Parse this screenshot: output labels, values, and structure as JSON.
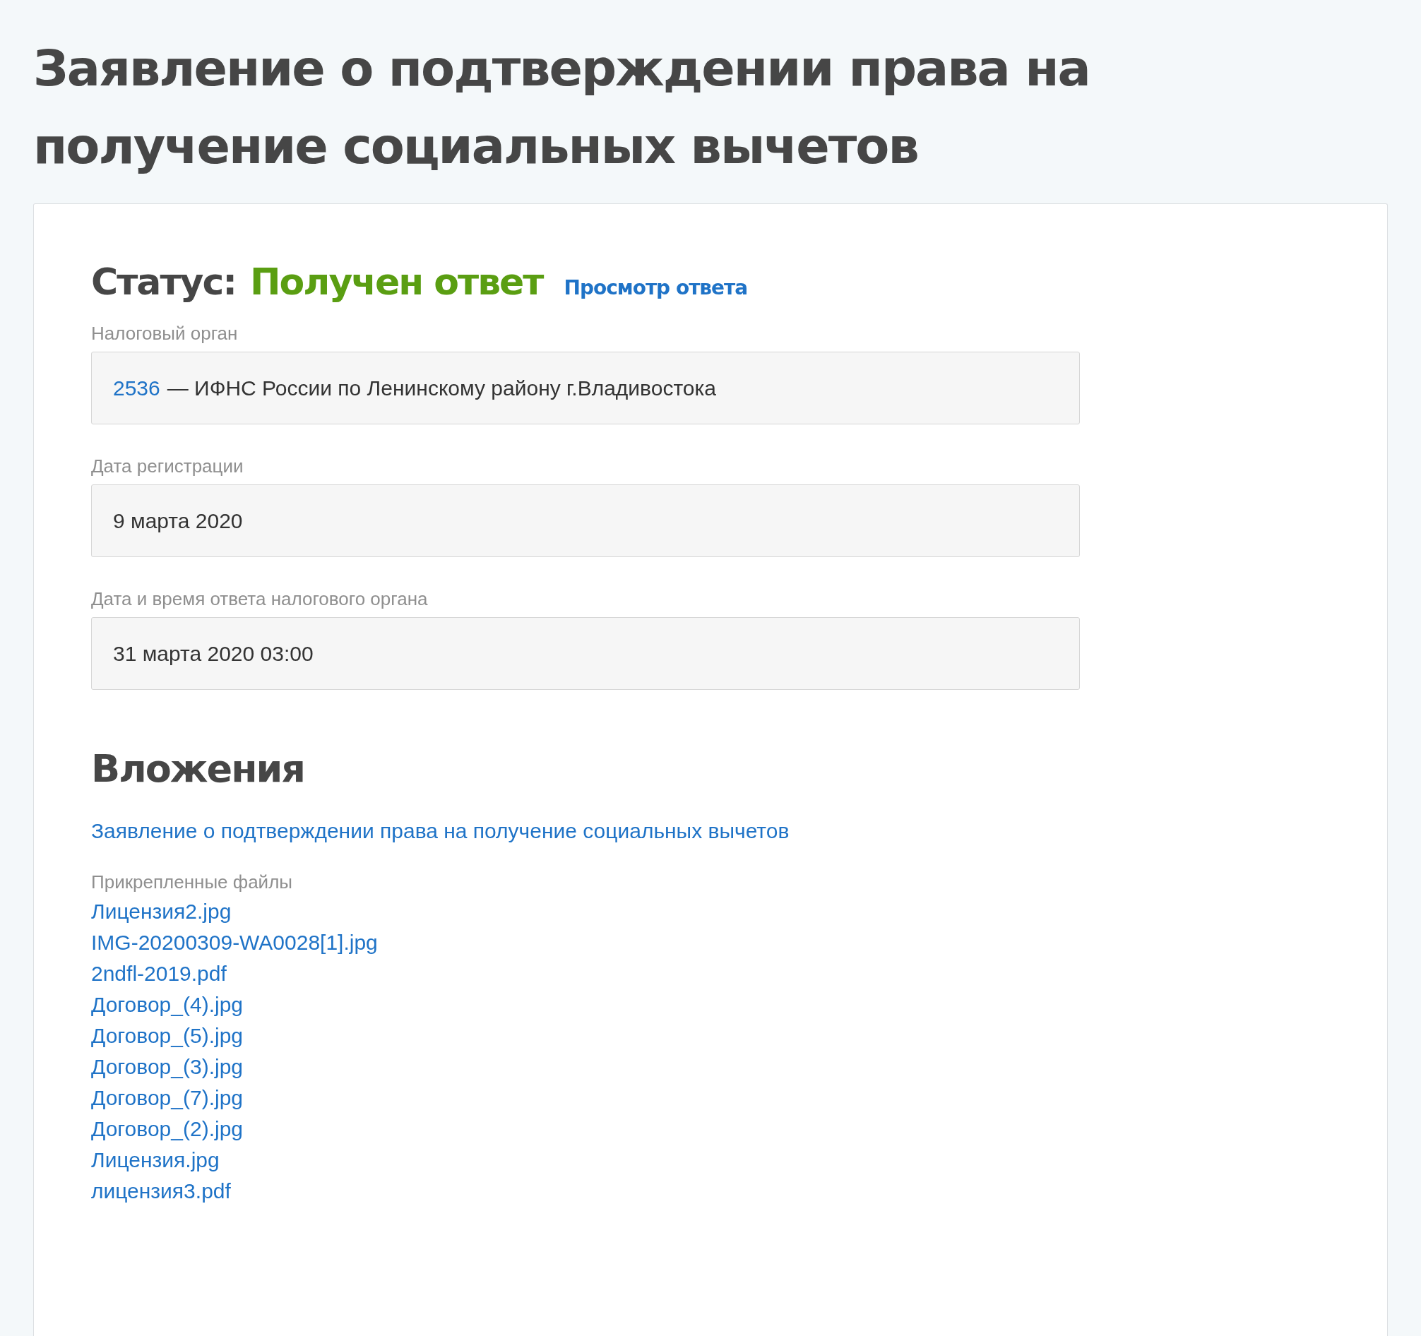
{
  "title": "Заявление о подтверждении права на получение социальных вычетов",
  "status": {
    "label": "Статус:",
    "value": "Получен ответ",
    "link": "Просмотр ответа"
  },
  "fields": [
    {
      "label": "Налоговый орган",
      "code": "2536",
      "value": "— ИФНС России по Ленинскому району г.Владивостока"
    },
    {
      "label": "Дата регистрации",
      "value": "9 марта 2020"
    },
    {
      "label": "Дата и время ответа налогового органа",
      "value": "31 марта 2020 03:00"
    }
  ],
  "attachments": {
    "heading": "Вложения",
    "document": "Заявление о подтверждении права на получение социальных вычетов",
    "files_label": "Прикрепленные файлы",
    "files": [
      "Лицензия2.jpg",
      "IMG-20200309-WA0028[1].jpg",
      "2ndfl-2019.pdf",
      "Договор_(4).jpg",
      "Договор_(5).jpg",
      "Договор_(3).jpg",
      "Договор_(7).jpg",
      "Договор_(2).jpg",
      "Лицензия.jpg",
      "лицензия3.pdf"
    ]
  }
}
